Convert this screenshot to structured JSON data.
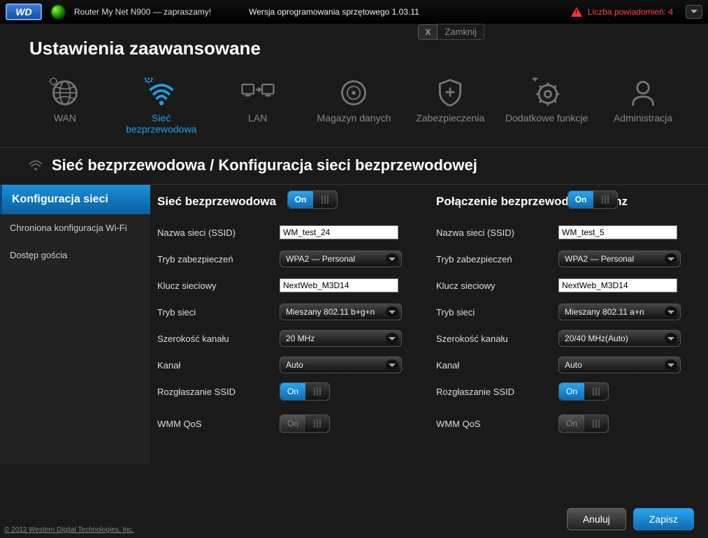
{
  "topbar": {
    "logo_text": "WD",
    "router_name": "Router My Net N900 — zapraszamy!",
    "firmware": "Wersja oprogramowania sprzętowego 1.03.11",
    "alerts": "Liczba powiadomień: 4"
  },
  "header": {
    "title": "Ustawienia zaawansowane",
    "close_label": "Zamknij",
    "close_x": "X"
  },
  "nav": {
    "items": [
      {
        "label": "WAN"
      },
      {
        "label": "Sieć bezprzewodowa"
      },
      {
        "label": "LAN"
      },
      {
        "label": "Magazyn danych"
      },
      {
        "label": "Zabezpieczenia"
      },
      {
        "label": "Dodatkowe funkcje"
      },
      {
        "label": "Administracja"
      }
    ]
  },
  "breadcrumb": "Sieć bezprzewodowa / Konfiguracja sieci bezprzewodowej",
  "sidebar": {
    "items": [
      {
        "label": "Konfiguracja sieci"
      },
      {
        "label": "Chroniona konfiguracja Wi-Fi"
      },
      {
        "label": "Dostęp gościa"
      }
    ]
  },
  "labels": {
    "ssid": "Nazwa sieci (SSID)",
    "security": "Tryb zabezpieczeń",
    "key": "Klucz sieciowy",
    "mode": "Tryb sieci",
    "width": "Szerokość kanału",
    "channel": "Kanał",
    "broadcast": "Rozgłaszanie SSID",
    "wmm": "WMM QoS",
    "on": "On"
  },
  "col1": {
    "title": "Sieć bezprzewodowa",
    "enabled": "On",
    "ssid": "WM_test_24",
    "security": "WPA2 — Personal",
    "key": "NextWeb_M3D14",
    "mode": "Mieszany 802.11 b+g+n",
    "width": "20 MHz",
    "channel": "Auto",
    "broadcast": "On",
    "wmm": "On"
  },
  "col2": {
    "title": "Połączenie bezprzewodowe 5 Ghz",
    "enabled": "On",
    "ssid": "WM_test_5",
    "security": "WPA2 — Personal",
    "key": "NextWeb_M3D14",
    "mode": "Mieszany 802.11 a+n",
    "width": "20/40 MHz(Auto)",
    "channel": "Auto",
    "broadcast": "On",
    "wmm": "On"
  },
  "footer": {
    "cancel": "Anuluj",
    "save": "Zapisz",
    "copyright": "© 2012 Western Digital Technologies, Inc."
  }
}
